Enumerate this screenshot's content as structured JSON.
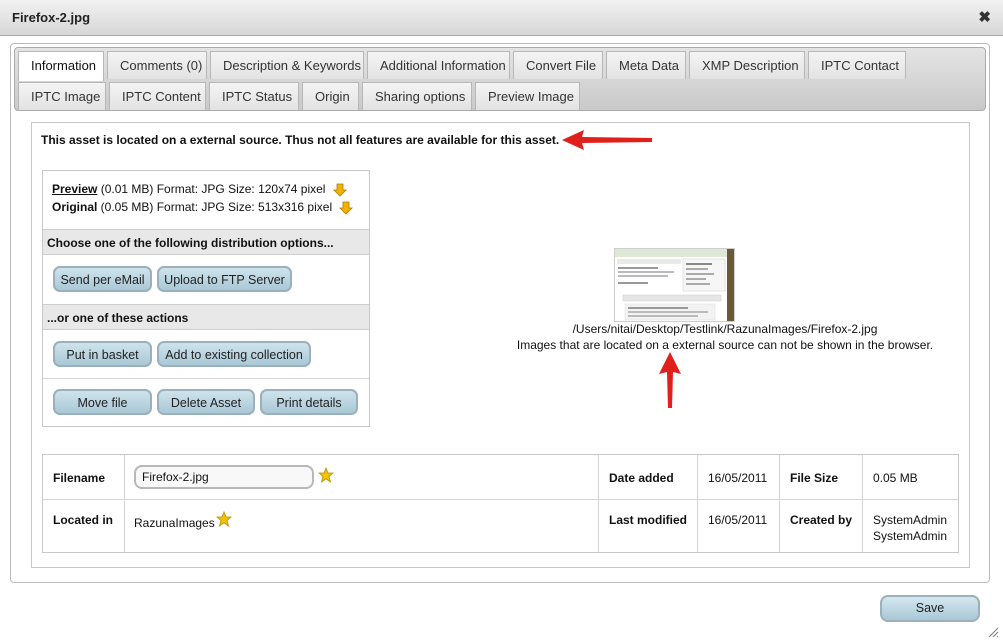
{
  "dialog": {
    "title": "Firefox-2.jpg",
    "close_icon": "close-icon"
  },
  "tabs": {
    "row1": [
      "Information",
      "Comments (0)",
      "Description & Keywords",
      "Additional Information",
      "Convert File",
      "Meta Data",
      "XMP Description",
      "IPTC Contact"
    ],
    "row2": [
      "IPTC Image",
      "IPTC Content",
      "IPTC Status",
      "Origin",
      "Sharing options",
      "Preview Image"
    ],
    "active": "Information"
  },
  "notice": "This asset is located on a external source. Thus not all features are available for this asset.",
  "files": {
    "preview": {
      "label": "Preview",
      "details": " (0.01 MB) Format: JPG Size: 120x74 pixel"
    },
    "original": {
      "label": "Original",
      "details": " (0.05 MB) Format: JPG Size: 513x316 pixel"
    },
    "download_icon": "download-arrow-icon"
  },
  "distribution": {
    "heading": "Choose one of the following distribution options...",
    "send_email": "Send per eMail",
    "upload_ftp": "Upload to FTP Server"
  },
  "actions": {
    "heading": "...or one of these actions",
    "put_in_basket": "Put in basket",
    "add_to_collection": "Add to existing collection",
    "move_file": "Move file",
    "delete_asset": "Delete Asset",
    "print_details": "Print details"
  },
  "preview": {
    "path": "/Users/nitai/Desktop/Testlink/RazunaImages/Firefox-2.jpg",
    "note": "Images that are located on a external source can not be shown in the browser."
  },
  "details": {
    "filename_label": "Filename",
    "filename_value": "Firefox-2.jpg",
    "located_in_label": "Located in",
    "located_in_value": "RazunaImages",
    "date_added_label": "Date added",
    "date_added_value": "16/05/2011",
    "last_modified_label": "Last modified",
    "last_modified_value": "16/05/2011",
    "file_size_label": "File Size",
    "file_size_value": "0.05 MB",
    "created_by_label": "Created by",
    "created_by_line1": "SystemAdmin",
    "created_by_line2": "SystemAdmin",
    "star_icon": "star-icon"
  },
  "footer": {
    "save": "Save"
  },
  "colors": {
    "button_fill": "#a9c8d6",
    "arrow_red": "#e0201b",
    "star_gold": "#f2c200"
  }
}
